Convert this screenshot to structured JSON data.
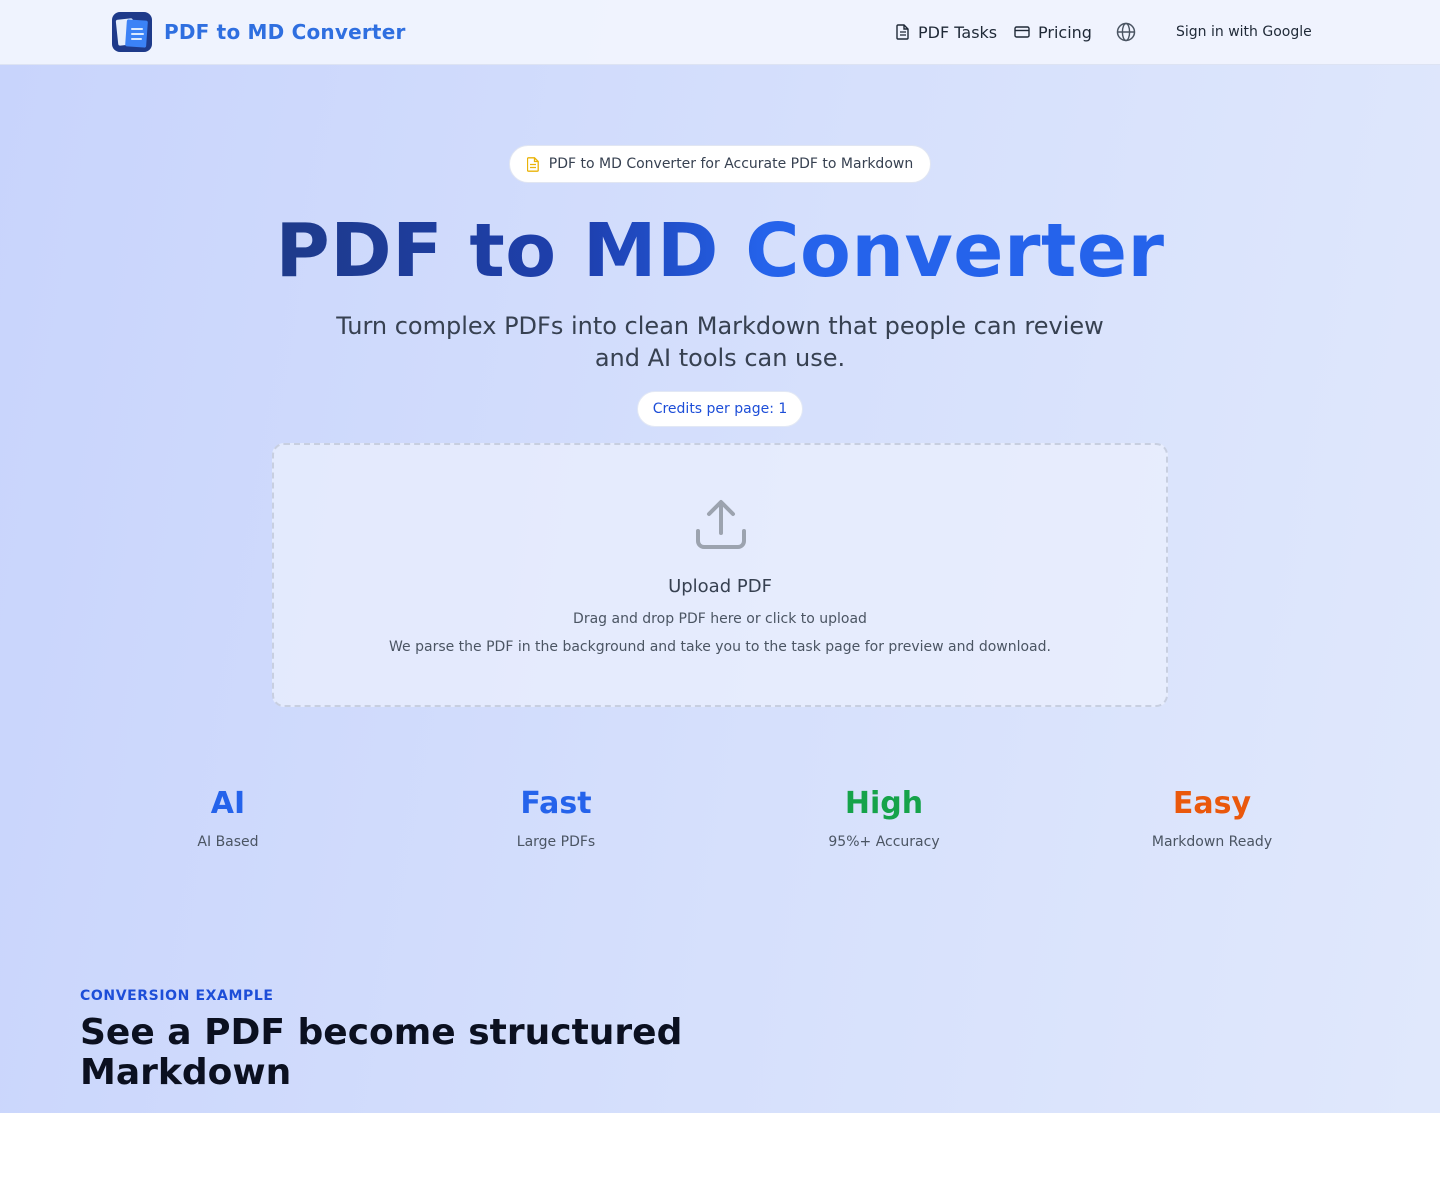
{
  "header": {
    "brand_name": "PDF to MD Converter",
    "nav": {
      "pdf_tasks": "PDF Tasks",
      "pricing": "Pricing"
    },
    "sign_in": "Sign in with Google"
  },
  "hero": {
    "badge": "PDF to MD Converter for Accurate PDF to Markdown",
    "title": "PDF to MD Converter",
    "subtitle": "Turn complex PDFs into clean Markdown that people can review and AI tools can use.",
    "credits": "Credits per page: 1"
  },
  "upload": {
    "title": "Upload PDF",
    "line1": "Drag and drop PDF here or click to upload",
    "line2": "We parse the PDF in the background and take you to the task page for preview and download."
  },
  "stats": [
    {
      "value": "AI",
      "label": "AI Based",
      "color": "#2563eb"
    },
    {
      "value": "Fast",
      "label": "Large PDFs",
      "color": "#2563eb"
    },
    {
      "value": "High",
      "label": "95%+ Accuracy",
      "color": "#16a34a"
    },
    {
      "value": "Easy",
      "label": "Markdown Ready",
      "color": "#ea580c"
    }
  ],
  "example": {
    "eyebrow": "CONVERSION EXAMPLE",
    "title": "See a PDF become structured Markdown"
  },
  "icons": {
    "brand": "document-stack-logo",
    "pdf_tasks": "file-text-icon",
    "pricing": "credit-card-icon",
    "language": "globe-icon",
    "badge": "document-icon",
    "upload": "upload-icon"
  },
  "colors": {
    "brand": "#2f6fe0",
    "accent": "#2563eb",
    "badge_icon": "#eab308"
  }
}
